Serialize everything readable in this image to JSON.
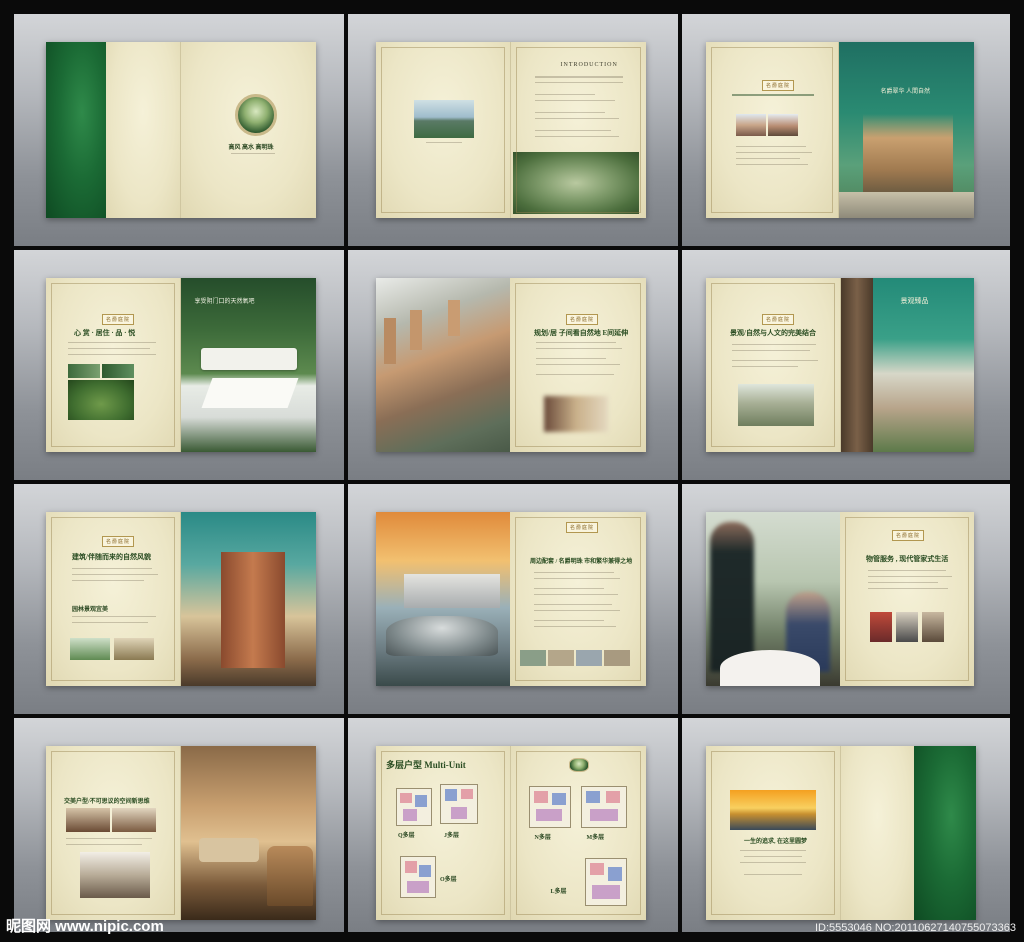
{
  "watermark": {
    "site": "昵图网 www.nipic.com",
    "id": "ID:5553046 NO:20110627140755073363"
  },
  "texts": {
    "cover_slogan": "高风 高水 高明珠",
    "intro_heading": "INTRODUCTION",
    "p3_badge": "名爵庭院",
    "p3_right_title": "名爵翠华 人間自然",
    "p4_heading": "心 赏 · 居住 · 品 · 悦",
    "p4_right_title": "享受阴门口的天然氧吧",
    "p5_heading": "规划/居 子间看自然地 E间延伸",
    "p6_heading": "景观/自然与人文的完美结合",
    "p6_right_title": "景观臻品",
    "p7_heading": "建筑/伴随而来的自然风貌",
    "p7_sub": "园林景观宜美",
    "p8_heading": "周边配套 / 名爵明珠 市和繁华兼得之地",
    "p9_heading": "物管服务 , 现代管家式生活",
    "p10_heading": "交美户型/不可思议的空间新思维",
    "p11_title": "多层户型 Multi-Unit",
    "p11_labels": [
      "Q多层",
      "J多层",
      "O多层",
      "N多层",
      "M多层",
      "L多层"
    ],
    "p12_heading": "一生的追求, 在这里圆梦"
  },
  "colors": {
    "accent_green": "#1b6b35",
    "paper": "#ece6c6",
    "frame_gray": "#9ea2a8"
  }
}
